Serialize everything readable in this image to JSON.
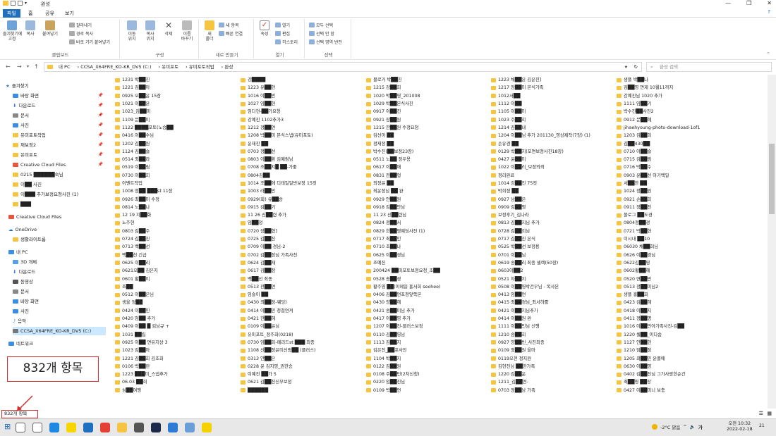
{
  "window": {
    "title": "완성",
    "qa_icons": [
      "save-icon",
      "undo-icon",
      "folder-icon"
    ],
    "controls": [
      "minimize",
      "maximize",
      "close"
    ]
  },
  "ribbon_tabs": [
    {
      "label": "파일"
    },
    {
      "label": "홈"
    },
    {
      "label": "공유"
    },
    {
      "label": "보기"
    }
  ],
  "ribbon": {
    "clipboard": {
      "pin": "즐겨찾기에\n고정",
      "copy": "복사",
      "paste": "붙여넣기",
      "cut": "잘라내기",
      "copy_path": "경로 복사",
      "paste_shortcut": "바로 가기 붙여넣기",
      "label": "클립보드"
    },
    "organize": {
      "move": "이동\n위치",
      "copy_to": "복사\n위치",
      "delete": "삭제",
      "rename": "이름\n바꾸기",
      "label": "구성"
    },
    "new": {
      "new_folder": "새\n폴더",
      "new_item": "새 항목",
      "easy_access": "빠른 연결",
      "label": "새로 만들기"
    },
    "open": {
      "properties": "속성",
      "open": "열기",
      "edit": "편집",
      "history": "히스토리",
      "label": "열기"
    },
    "select": {
      "select_all": "모두 선택",
      "select_none": "선택 안 함",
      "invert": "선택 영역 반전",
      "label": "선택"
    }
  },
  "address": {
    "crumbs": [
      "내 PC",
      "CCSA_X64FRE_KO-KR_DV5 (C:)",
      "유미포토",
      "유미포토작업",
      "완성"
    ],
    "search_placeholder": "완성 검색"
  },
  "nav": {
    "quick_access": "즐겨찾기",
    "items": [
      "바탕 화면",
      "다운로드",
      "문서",
      "사진",
      "유미포토작업",
      "재보정2",
      "유미포토",
      "Creative Cloud Files",
      "0215 ██████숙님",
      "이██ 사진",
      "이███ 추가보정요청사진 (1)",
      "███"
    ],
    "creative_cloud": "Creative Cloud Files",
    "onedrive": "OneDrive",
    "onedrive_sub": "생활라이트룸",
    "this_pc": "내 PC",
    "pc_items": [
      "3D 개체",
      "다운로드",
      "동영상",
      "문서",
      "바탕 화면",
      "사진",
      "음악",
      "CCSA_X64FRE_KO-KR_DV5 (C:)"
    ],
    "network": "네트워크"
  },
  "files": [
    [
      "1231 박██진",
      "1221 김██아",
      "0925 오██윤 15장",
      "1021 이██윤",
      "1023_김██미",
      "1109 문██미",
      "1122 ████포토(노승██",
      "0416 이██수님",
      "1202 김██원",
      "1124 김██슬",
      "0514 최██라",
      "0519 이██림",
      "0730 이██희",
      "이벤트작업",
      "1008 정██ ███st 11장",
      "0926 최██미 수정",
      "0814 노██나",
      "12 19 지██화",
      "노주현",
      "0803 김██주",
      "0724 김██진",
      "0713 백██선",
      "백██선 긴급",
      "0625 이██리",
      "0621오██ 김은지",
      "0601 황██이",
      "조██",
      "0512 이██은님",
      "생을 정██",
      "0424 이██민",
      "0420 임██ 추가",
      "0409 이██ █ 김남규 +",
      "1031 ██립",
      "0925 이██ 면유지상 3",
      "1023 김██아",
      "1221 김██희 김조희",
      "0106 박██란",
      "1223 ███미_스냅추가",
      "06.03 ██희",
      "심██여행"
    ],
    [
      "강████",
      "1223 유██현",
      "1016 이██빈",
      "1027 임██현",
      "임다현-██가요청",
      "강예진 1102추가3",
      "1212 정██연",
      "1208 박██미 본식스냅(유미포토)",
      "윤재진 ██",
      "0703 정██선",
      "0803 이██환 김예림님",
      "0708 조██지█ ██-가좋",
      "0804김██",
      "1014 조██에 디테일일반보정 15컷",
      "1003 라██민",
      "0929(화) 유██송",
      "0915 김██기",
      "11 26 신██련 추가",
      "임██정",
      "0720 장██형]",
      "0725 김██진",
      "0709 이██ 경님-2",
      "0702 김██정님 가족사진",
      "0624 김██재",
      "0617 김██정",
      "백██선 최종",
      "0513 전██연",
      "임슬이 ██",
      "0430 최██정-웨딩)",
      "0414 이██민 청첩연져",
      "0421 한██해",
      "0109 이██윤님",
      "유미포토_정주희(0218)",
      "0730 임██희-메리드st ███ 최종",
      "1108 신██정윤미신랑██ (플러스)",
      "0313 안██은",
      "0228 윤 김지영_권한승",
      "이예진 ██가 5",
      "0621 김██진신부보정",
      "██████"
    ],
    [
      "블로거 박██진",
      "1215 강██희",
      "1020 박██영_201008",
      "1029 박██본식사진",
      "0917 이██진",
      "0921 장██원",
      "1215 한██원 수정요청",
      "김선아 ██",
      "정재정 ██",
      "박수진(██보정23장)",
      "0511 노██ 정우용",
      "0617 이██애",
      "0831 전██형",
      "최정윤 ██",
      "최윤정님 ██ 완",
      "0929 안██원",
      "0918 김██안님",
      "11 23 신██련님",
      "0824 정██서",
      "0829 한██영웨딩사진 (1)",
      "0717 최██인",
      "0710 조██나",
      "0625 이██경님",
      "조예진",
      "200424 ██미포토보정요청_조██",
      "0528 송██경",
      "황주영 ██(이메일 홍서희 seohee)",
      "0406 김██연포정앞쪽본",
      "0430 양██해",
      "0421 송██미님 추가",
      "0417 이██영 추가",
      "1207 이██진-블러스보정",
      "0110 김██영님",
      "1113 김██지",
      "김은진_██포사진",
      "1104 박██지",
      "0122 김██원",
      "0108 주██민(2차신청)",
      "0220 임██진님",
      "0109 박██연"
    ],
    [
      "1223 채██윤 김윤진]",
      "1217 장██미 본식가족",
      "1012서██",
      "1112 이██",
      "1105 이██미",
      "1023 주██희",
      "1214 김██내",
      "1204 이██님 추가 201130_영상제작(7장) (1)",
      "손유경 ██",
      "0129 박██지(포면보정사진18장)",
      "0427 윤██미",
      "1022 이██리_보정의뢰",
      "정리완료",
      "1014 강██진 75컷",
      "박희정 ██",
      "0927 남██은",
      "0909 김██영",
      "보정후기_김나라",
      "0813 김██지님 추가",
      "0728 김██희님",
      "0717 김██진 본식",
      "0525 박██선 보정용",
      "0701 이██님",
      "0619 송██리 최종 셀렉(50장)",
      "0603이██2",
      "0521 차██지",
      "0508 이██영박건우님 - 복사본",
      "0413 임██연",
      "0415 최██경님_최서하를",
      "0421 이██지님추가",
      "0414 이██원 완",
      "1111 이██민님 신행",
      "1210 송██희",
      "0927 양██빈_사진최종",
      "0109 정██원 을마",
      "0119오전 정지원",
      "김현진님 ██한가족",
      "1220 김██운",
      "1211_김██연-",
      "0703 정██남 가족"
    ],
    [
      "생플 박██나",
      "김██영 면제 10월11까지",
      "강예진님 1020 추가",
      "1111 임██기",
      "박수진██사진2",
      "0912 문██혜",
      "jihaehyoung-photo-download-1of1",
      "1203 김██희",
      "김██430██",
      "0710 이██슬",
      "0715 김██림",
      "0716 박██수",
      "0903 윤██선 아기백일",
      "서██한 ██",
      "1024 정██원",
      "0921 손██희",
      "0911 정██진",
      "블로그 ██도경",
      "0804정██경",
      "0721 박██현",
      "이시내 ██10",
      "06030 채██희님",
      "0626 이██경님",
      "0622김██영",
      "0602황██혜",
      "0520 연██빈",
      "0513 정██미님2",
      "생플 홍██희",
      "0423 김██해",
      "0418 이██지",
      "0411 정██명",
      "1016 이██민아가족사진-김██",
      "1220 셀██_이다솜",
      "1127 안██현",
      "1210 임██정",
      "1205 최██민 윤플에",
      "0630 이██영",
      "0402 김██진님 그가사랑한순간",
      "최██영 ██장",
      "0427 이██미니 보충"
    ]
  ],
  "scroll_values": [],
  "status": {
    "count": "832개 항목"
  },
  "callout": {
    "text": "832개 항목"
  },
  "taskbar": {
    "apps": [
      "search-icon",
      "task-view-icon",
      "edge-icon",
      "kakao-icon",
      "mail-icon",
      "chrome-icon",
      "explorer-icon",
      "calculator-icon",
      "photoshop-icon",
      "photos-icon",
      "store-icon",
      "kakaotalk-icon"
    ],
    "weather": "-2°C 맑음",
    "ime": "가",
    "time": "오전 10:32",
    "date": "2022-02-18",
    "notifications": "21"
  }
}
